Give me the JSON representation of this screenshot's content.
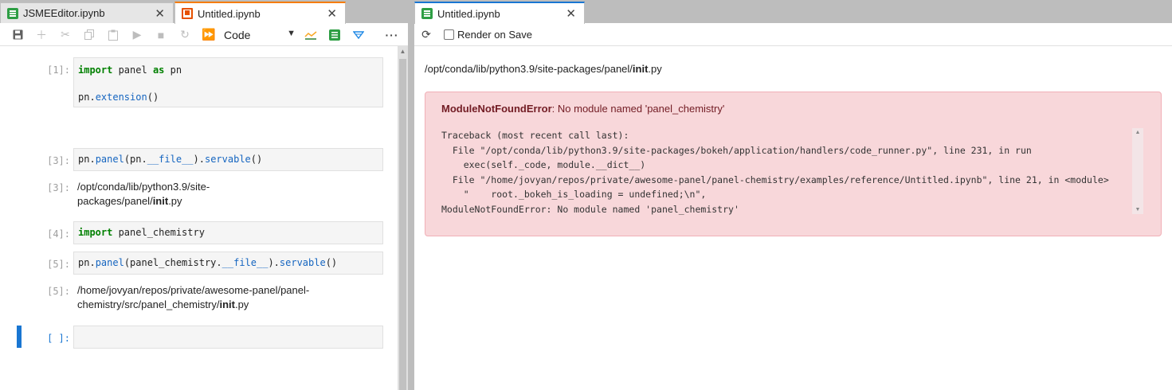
{
  "left": {
    "tabs": [
      {
        "label": "JSMEEditor.ipynb",
        "close": "✕",
        "icon": "notebook-green-icon"
      },
      {
        "label": "Untitled.ipynb",
        "close": "✕",
        "icon": "notebook-orange-icon"
      }
    ],
    "toolbar": {
      "cell_type": "Code",
      "chevron": "⌄",
      "buttons": [
        "save-icon",
        "add-icon",
        "cut-icon",
        "copy-icon",
        "paste-icon",
        "run-icon",
        "stop-icon",
        "restart-icon",
        "fast-forward-icon",
        "chart-icon",
        "notebook-icon",
        "panel-icon",
        "more-icon"
      ]
    },
    "cells": [
      {
        "prompt": "[1]:",
        "lines": [
          "import panel as pn",
          "",
          "pn.extension()"
        ]
      },
      {
        "prompt": "[3]:",
        "lines": [
          "pn.panel(pn.__file__).servable()"
        ]
      },
      {
        "out_prompt": "[3]:",
        "output": "/opt/conda/lib/python3.9/site-packages/panel/init.py"
      },
      {
        "prompt": "[4]:",
        "lines": [
          "import panel_chemistry"
        ]
      },
      {
        "prompt": "[5]:",
        "lines": [
          "pn.panel(panel_chemistry.__file__).servable()"
        ]
      },
      {
        "out_prompt": "[5]:",
        "output": "/home/jovyan/repos/private/awesome-panel/panel-chemistry/src/panel_chemistry/init.py"
      },
      {
        "prompt": "[ ]:",
        "lines": [
          ""
        ]
      }
    ],
    "out3_line1": "/opt/conda/lib/python3.9/site-",
    "out3_line2a": "packages/panel/",
    "out3_line2b": "init",
    "out3_line2c": ".py",
    "out5_line1": "/home/jovyan/repos/private/awesome-panel/panel-",
    "out5_line2a": "chemistry/src/panel_chemistry/",
    "out5_line2b": "init",
    "out5_line2c": ".py"
  },
  "right": {
    "tab": {
      "label": "Untitled.ipynb",
      "close": "✕",
      "icon": "notebook-green-icon"
    },
    "reload": "⟳",
    "render_on_save": "Render on Save",
    "render_on_save_checked": false,
    "path_a": "/opt/conda/lib/python3.9/site-packages/panel/",
    "path_b": "init",
    "path_c": ".py",
    "error": {
      "type": "ModuleNotFoundError",
      "message": ": No module named 'panel_chemistry'",
      "traceback": [
        "Traceback (most recent call last):",
        "  File \"/opt/conda/lib/python3.9/site-packages/bokeh/application/handlers/code_runner.py\", line 231, in run",
        "    exec(self._code, module.__dict__)",
        "  File \"/home/jovyan/repos/private/awesome-panel/panel-chemistry/examples/reference/Untitled.ipynb\", line 21, in <module>",
        "    \"    root._bokeh_is_loading = undefined;\\n\",",
        "ModuleNotFoundError: No module named 'panel_chemistry'"
      ]
    }
  }
}
